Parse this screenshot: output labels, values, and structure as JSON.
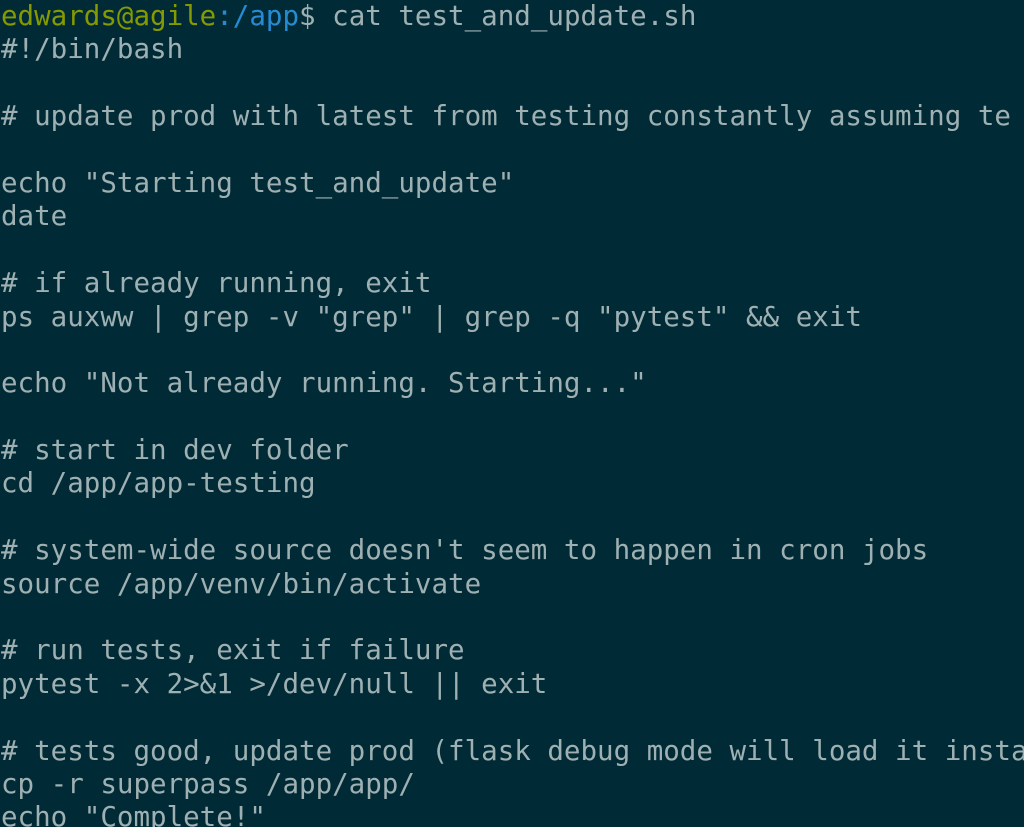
{
  "prompt": {
    "user_host": "edwards@agile",
    "path": ":/app",
    "symbol": "$",
    "command": " cat test_and_update.sh"
  },
  "colors": {
    "background": "#002b36",
    "text": "#9fb0b2",
    "user_host": "#859900",
    "path": "#268bd2"
  },
  "lines": [
    "#!/bin/bash",
    "",
    "# update prod with latest from testing constantly assuming te",
    "",
    "echo \"Starting test_and_update\"",
    "date",
    "",
    "# if already running, exit",
    "ps auxww | grep -v \"grep\" | grep -q \"pytest\" && exit",
    "",
    "echo \"Not already running. Starting...\"",
    "",
    "# start in dev folder",
    "cd /app/app-testing",
    "",
    "# system-wide source doesn't seem to happen in cron jobs",
    "source /app/venv/bin/activate",
    "",
    "# run tests, exit if failure",
    "pytest -x 2>&1 >/dev/null || exit",
    "",
    "# tests good, update prod (flask debug mode will load it insta",
    "cp -r superpass /app/app/",
    "echo \"Complete!\""
  ]
}
